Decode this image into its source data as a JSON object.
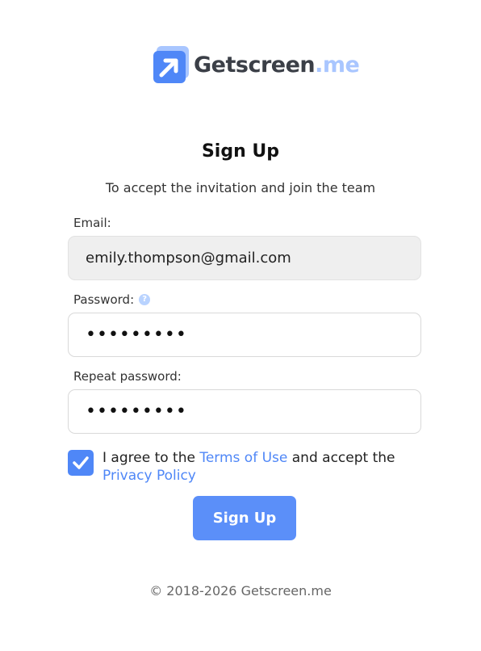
{
  "logo": {
    "name_main": "Getscreen",
    "name_tld": ".me",
    "icon": "arrow-up-right-icon"
  },
  "title": "Sign Up",
  "subtitle": "To accept the invitation and join the team",
  "form": {
    "email_label": "Email:",
    "email_value": "emily.thompson@gmail.com",
    "password_label": "Password:",
    "password_value": "•••••••••",
    "password_help_icon": "question-circle-icon",
    "repeat_label": "Repeat password:",
    "repeat_value": "•••••••••",
    "agree": {
      "checked": true,
      "text_1": "I agree to the ",
      "terms_link": "Terms of Use",
      "text_2": " and accept the ",
      "privacy_link": "Privacy Policy"
    },
    "submit_label": "Sign Up"
  },
  "footer": "© 2018-2026 Getscreen.me",
  "colors": {
    "accent": "#4f87f7",
    "accent_light": "#a9c6ff",
    "text_dark": "#3b3f47"
  }
}
